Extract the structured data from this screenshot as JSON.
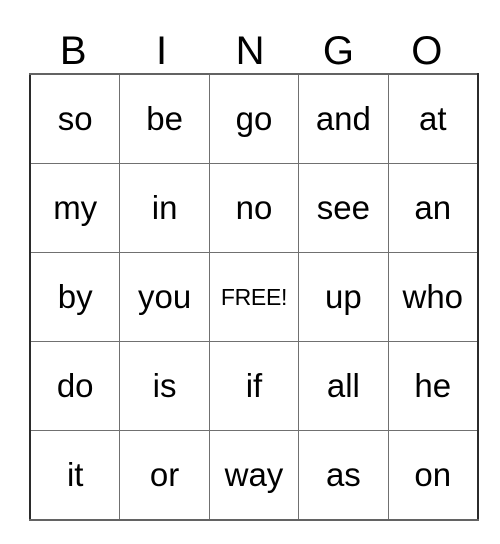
{
  "card": {
    "title": "BINGO",
    "headers": [
      "B",
      "I",
      "N",
      "G",
      "O"
    ],
    "free_space_label": "FREE!",
    "free_space_position": {
      "row": 2,
      "col": 2
    },
    "colors": {
      "grid_line": "#707070",
      "grid_outer": "#2b2b2b",
      "text": "#000000",
      "cell_background": "#ffffff",
      "page_background": "#ffffff"
    },
    "rows": [
      {
        "cells": [
          "so",
          "be",
          "go",
          "and",
          "at"
        ]
      },
      {
        "cells": [
          "my",
          "in",
          "no",
          "see",
          "an"
        ]
      },
      {
        "cells": [
          "by",
          "you",
          "FREE!",
          "up",
          "who"
        ]
      },
      {
        "cells": [
          "do",
          "is",
          "if",
          "all",
          "he"
        ]
      },
      {
        "cells": [
          "it",
          "or",
          "way",
          "as",
          "on"
        ]
      }
    ]
  }
}
